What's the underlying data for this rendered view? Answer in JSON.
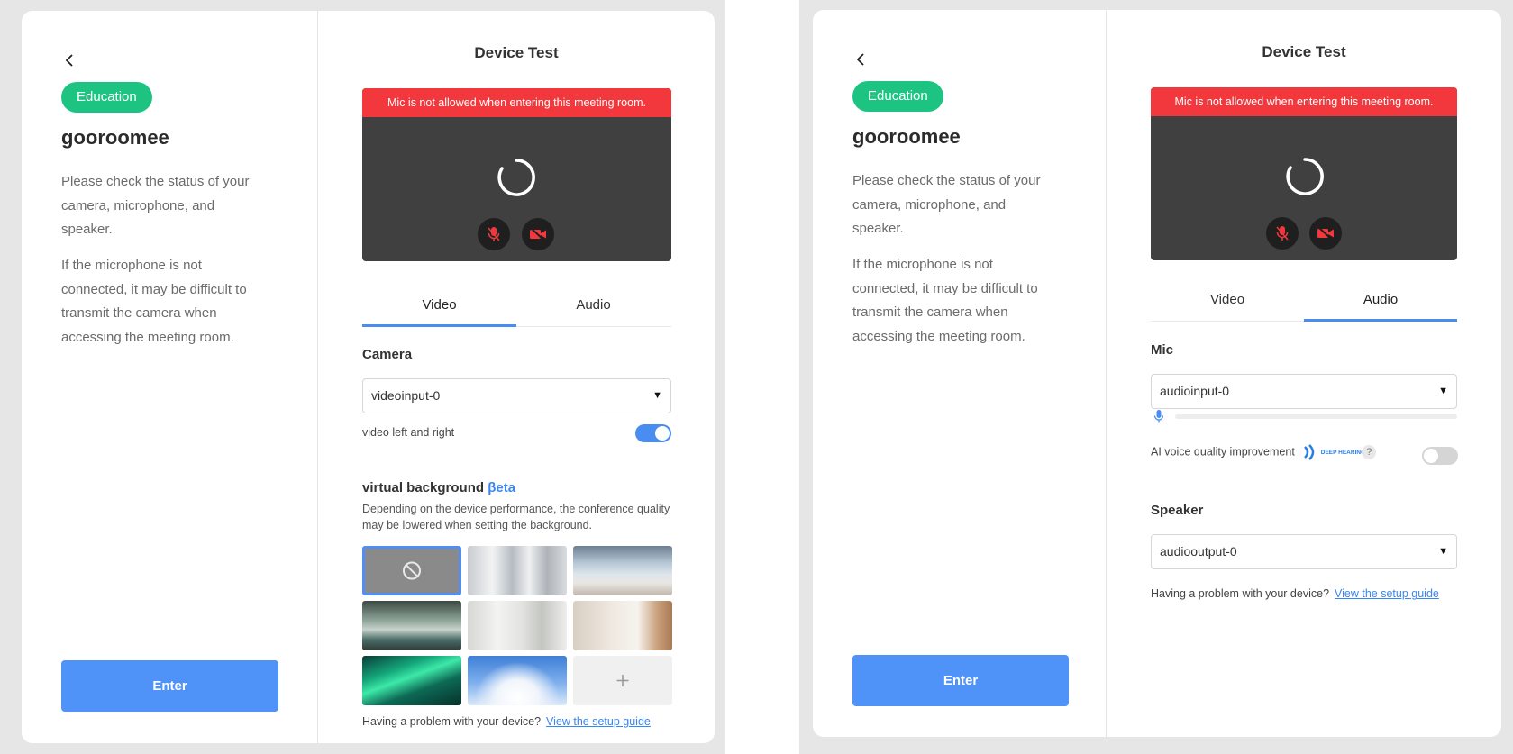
{
  "colors": {
    "badge": "#1dc481",
    "enter": "#4f93f8",
    "alert": "#f2383c",
    "accent": "#3a86f0",
    "toggle_on": "#4a8df0",
    "toggle_off": "#d5d5d5"
  },
  "left_panel": {
    "badge": "Education",
    "brand": "gooroomee",
    "desc1": "Please check the status of your camera, microphone, and speaker.",
    "desc2": "If the microphone is not connected, it may be difficult to transmit the camera when accessing the meeting room.",
    "enter": "Enter"
  },
  "device_test": {
    "title": "Device Test",
    "alert": "Mic is not allowed when entering this meeting room.",
    "tabs": [
      "Video",
      "Audio"
    ]
  },
  "video_tab": {
    "camera_label": "Camera",
    "camera_value": "videoinput-0",
    "mirror_label": "video left and right",
    "mirror_on": true,
    "vb_title": "virtual background",
    "vb_beta": "βeta",
    "vb_desc": "Depending on the device performance, the conference quality may be lowered when setting the background.",
    "backgrounds": [
      "none-icon",
      "blur-background",
      "living-room-window",
      "kitchen-room",
      "white-shelf-room",
      "wooden-shelf-room",
      "aurora",
      "clouds-sky",
      "add-icon"
    ],
    "selected_background": "none-icon"
  },
  "audio_tab": {
    "mic_label": "Mic",
    "mic_value": "audioinput-0",
    "mic_level": 0,
    "ai_label": "AI voice quality improvement",
    "deep_hearing": "DEEP HEARING",
    "help": "?",
    "ai_on": false,
    "speaker_label": "Speaker",
    "speaker_value": "audiooutput-0"
  },
  "footer": {
    "problem": "Having a problem with your device?",
    "guide": "View the setup guide"
  }
}
